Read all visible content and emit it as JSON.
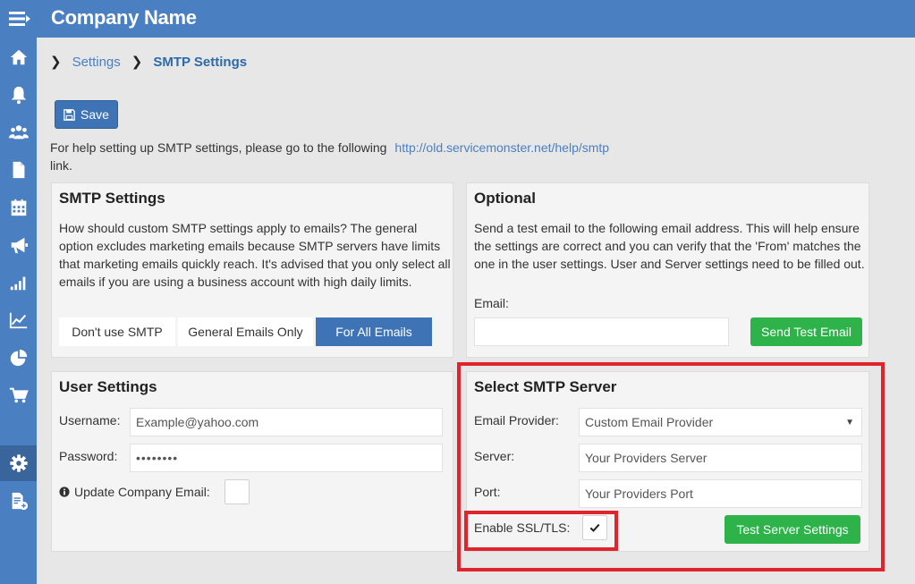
{
  "header": {
    "company_name": "Company Name"
  },
  "sidebar": {
    "items": [
      {
        "icon": "home-icon"
      },
      {
        "icon": "bell-icon"
      },
      {
        "icon": "users-icon"
      },
      {
        "icon": "document-icon"
      },
      {
        "icon": "calendar-icon"
      },
      {
        "icon": "megaphone-icon"
      },
      {
        "icon": "bar-chart-icon"
      },
      {
        "icon": "line-chart-icon"
      },
      {
        "icon": "pie-chart-icon"
      },
      {
        "icon": "cart-icon"
      },
      {
        "icon": "gear-icon",
        "active": true
      },
      {
        "icon": "add-document-icon"
      }
    ]
  },
  "breadcrumb": {
    "parent": "Settings",
    "current": "SMTP Settings"
  },
  "toolbar": {
    "save_label": "Save"
  },
  "help": {
    "text": "For help setting up SMTP settings, please go to the following",
    "link": "http://old.servicemonster.net/help/smtp",
    "suffix": "link."
  },
  "smtp_settings": {
    "title": "SMTP Settings",
    "description": "How should custom SMTP settings apply to emails? The general option excludes marketing emails because SMTP servers have limits that marketing emails quickly reach. It's advised that you only select all emails if you are using a business account with high daily limits.",
    "options": [
      "Don't use SMTP",
      "General Emails Only",
      "For All Emails"
    ],
    "selected": "For All Emails"
  },
  "optional": {
    "title": "Optional",
    "description": "Send a test email to the following email address. This will help ensure the settings are correct and you can verify that the 'From' matches the one in the user settings. User and Server settings need to be filled out.",
    "email_label": "Email:",
    "email_value": "",
    "send_button": "Send Test Email"
  },
  "user_settings": {
    "title": "User Settings",
    "username_label": "Username:",
    "username_value": "Example@yahoo.com",
    "password_label": "Password:",
    "password_value": "••••••••",
    "update_label": "Update Company Email:",
    "update_checked": false
  },
  "server": {
    "title": "Select SMTP Server",
    "provider_label": "Email Provider:",
    "provider_value": "Custom Email Provider",
    "server_label": "Server:",
    "server_value": "Your Providers Server",
    "port_label": "Port:",
    "port_value": "Your Providers Port",
    "ssl_label": "Enable SSL/TLS:",
    "ssl_checked": true,
    "test_button": "Test Server Settings"
  },
  "colors": {
    "brand": "#4a7fc1",
    "primary_button": "#3e74b6",
    "success": "#2db34a",
    "highlight": "#e0242b"
  }
}
